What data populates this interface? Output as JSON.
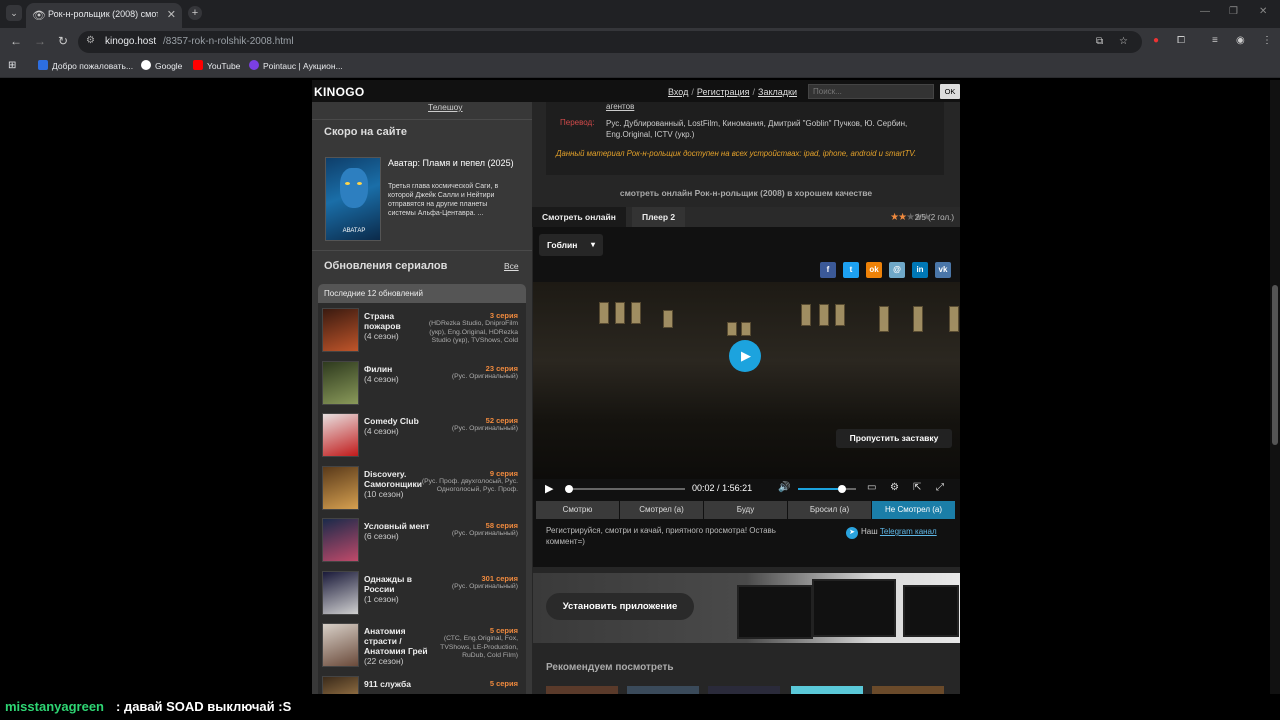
{
  "browser": {
    "tab_title": "Рок-н-рольщик (2008) смотре",
    "url_host": "kinogo.host",
    "url_path": "/8357-rok-n-rolshik-2008.html",
    "bookmarks": [
      {
        "label": "Добро пожаловать...",
        "color": "#2d6ee0"
      },
      {
        "label": "Google",
        "color": "#ffffff"
      },
      {
        "label": "YouTube",
        "color": "#ff0000"
      },
      {
        "label": "Pointauc | Аукцион...",
        "color": "#7b3fe4"
      }
    ]
  },
  "site": {
    "logo": "KINOGO",
    "links": [
      "Вход",
      "Регистрация",
      "Закладки"
    ],
    "search_placeholder": "Поиск...",
    "search_button": "OK"
  },
  "sidebar": {
    "top_link": "Телешоу",
    "soon_heading": "Скоро на сайте",
    "soon": {
      "poster_text": "АВАТАР",
      "title": "Аватар: Пламя и пепел (2025)",
      "desc": "Третья глава космической Саги, в которой Джейк Салли и Нейтири отправятся на другие планеты системы Альфа-Центавра. ..."
    },
    "series_heading": "Обновления сериалов",
    "all_link": "Все",
    "updates_header": "Последние 12 обновлений",
    "updates": [
      {
        "title": "Страна пожаров",
        "season": "(4 сезон)",
        "episode": "3 серия",
        "tr": "(HDRezka Studio, DniproFilm (укр), Eng.Original, HDRezka Studio (укр), TVShows, Cold",
        "c1": "#3a1a10",
        "c2": "#c0552a"
      },
      {
        "title": "Филин",
        "season": "(4 сезон)",
        "episode": "23 серия",
        "tr": "(Рус. Оригинальный)",
        "c1": "#2e3a1e",
        "c2": "#8a9a5a"
      },
      {
        "title": "Comedy Club",
        "season": "(4 сезон)",
        "episode": "52 серия",
        "tr": "(Рус. Оригинальный)",
        "c1": "#e8e0e0",
        "c2": "#c01a1a"
      },
      {
        "title": "Discovery. Самогонщики",
        "season": "(10 сезон)",
        "episode": "9 серия",
        "tr": "(Рус. Проф. двухголосый, Рус. Одноголосый, Рус. Проф.",
        "c1": "#5a3a1a",
        "c2": "#d6a050"
      },
      {
        "title": "Условный мент",
        "season": "(6 сезон)",
        "episode": "58 серия",
        "tr": "(Рус. Оригинальный)",
        "c1": "#1a2a4a",
        "c2": "#c04a6a"
      },
      {
        "title": "Однажды в России",
        "season": "(1 сезон)",
        "episode": "301 серия",
        "tr": "(Рус. Оригинальный)",
        "c1": "#1a1a3a",
        "c2": "#d0d0d0"
      },
      {
        "title": "Анатомия страсти / Анатомия Грей",
        "season": "(22 сезон)",
        "episode": "5 серия",
        "tr": "(СТС, Eng.Original, Fox, TVShows, LE-Production, RuDub, Cold Film)",
        "c1": "#d8d0c8",
        "c2": "#6a4a3a"
      },
      {
        "title": "911 служба",
        "season": "",
        "episode": "5 серия",
        "tr": "",
        "c1": "#3a2a1a",
        "c2": "#d0a060"
      }
    ]
  },
  "main": {
    "agents": "агентов",
    "translation_label": "Перевод:",
    "translation_value": "Рус. Дублированный, LostFilm, Киномания, Дмитрий \"Goblin\" Пучков, Ю. Сербин, Eng.Original, ICTV (укр.)",
    "note": "Данный материал Рок-н-рольщик доступен на всех устройствах: ipad, iphone, android и smartTV.",
    "watch_caption": "смотреть онлайн Рок-н-рольщик (2008) в хорошем качестве",
    "tab1": "Смотреть онлайн",
    "tab2": "Плеер 2",
    "rating": "2/5 (2 гол.)",
    "rating_value": 2,
    "voice": "Гоблин",
    "share": [
      {
        "icon": "facebook-icon",
        "glyph": "f",
        "color": "#3b5998"
      },
      {
        "icon": "twitter-icon",
        "glyph": "t",
        "color": "#1da1f2"
      },
      {
        "icon": "odnoklassniki-icon",
        "glyph": "ok",
        "color": "#ee8208"
      },
      {
        "icon": "mailru-icon",
        "glyph": "@",
        "color": "#6fa8c8"
      },
      {
        "icon": "linkedin-icon",
        "glyph": "in",
        "color": "#0077b5"
      },
      {
        "icon": "vk-icon",
        "glyph": "vk",
        "color": "#4a76a8"
      }
    ],
    "skip": "Пропустить заставку",
    "time_current": "00:02",
    "time_sep": "/",
    "time_total": "1:56:21",
    "progress": 0.0003,
    "volume": 0.75,
    "statuses": [
      "Смотрю",
      "Смотрел (а)",
      "Буду",
      "Бросил (а)",
      "Не Смотрел (а)"
    ],
    "reg_text": "Регистрируйся, смотри и качай, приятного просмотра! Оставь коммент=)",
    "tg_prefix": "Наш",
    "tg_link": "Telegram канал",
    "install_app": "Установить приложение",
    "recommend": "Рекомендуем посмотреть"
  },
  "chat": {
    "user": "misstanyagreen",
    "message": ": давай SOAD выключай :S"
  }
}
